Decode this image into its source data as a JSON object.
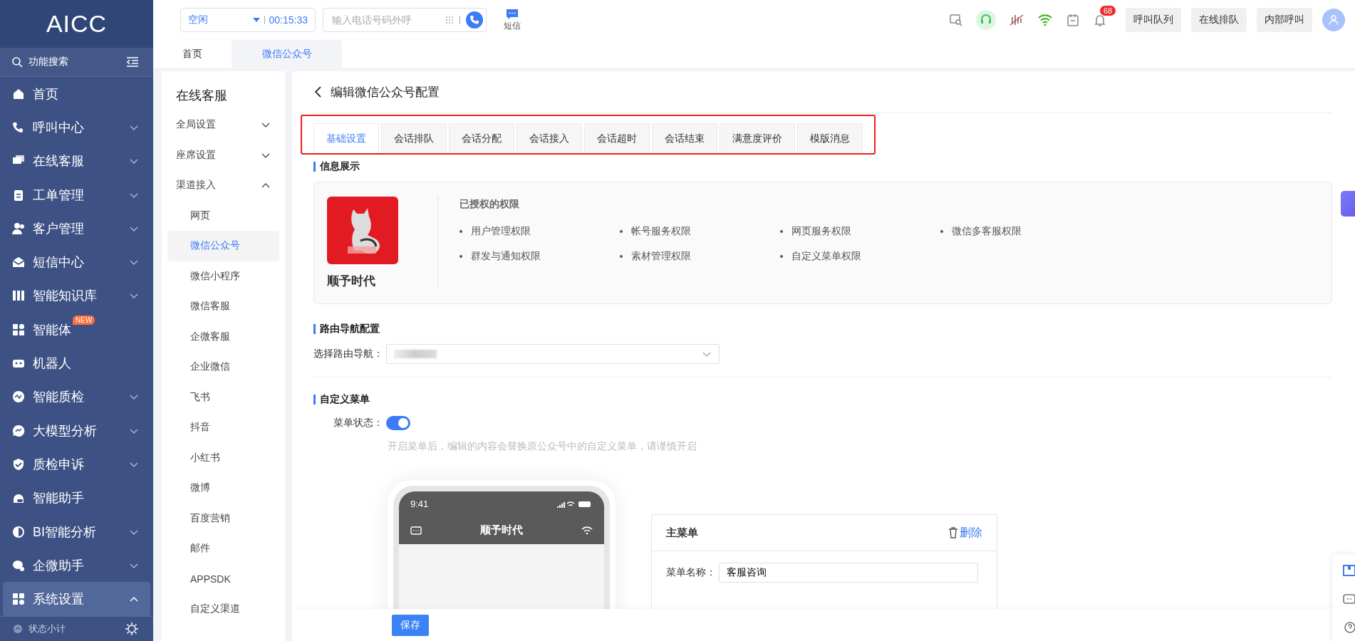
{
  "sidebar": {
    "logo": "AICC",
    "search": "功能搜索",
    "items": [
      {
        "label": "首页",
        "has_children": false,
        "selected": false
      },
      {
        "label": "呼叫中心",
        "has_children": true,
        "expanded": false,
        "selected": false
      },
      {
        "label": "在线客服",
        "has_children": true,
        "expanded": false,
        "selected": false
      },
      {
        "label": "工单管理",
        "has_children": true,
        "expanded": false,
        "selected": false
      },
      {
        "label": "客户管理",
        "has_children": true,
        "expanded": false,
        "selected": false
      },
      {
        "label": "短信中心",
        "has_children": true,
        "expanded": false,
        "selected": false
      },
      {
        "label": "智能知识库",
        "has_children": true,
        "expanded": false,
        "selected": false
      },
      {
        "label": "智能体",
        "has_children": false,
        "selected": false,
        "badge": "NEW"
      },
      {
        "label": "机器人",
        "has_children": false,
        "selected": false
      },
      {
        "label": "智能质检",
        "has_children": true,
        "expanded": false,
        "selected": false
      },
      {
        "label": "大模型分析",
        "has_children": true,
        "expanded": false,
        "selected": false
      },
      {
        "label": "质检申诉",
        "has_children": true,
        "expanded": false,
        "selected": false
      },
      {
        "label": "智能助手",
        "has_children": false,
        "selected": false
      },
      {
        "label": "BI智能分析",
        "has_children": true,
        "expanded": false,
        "selected": false
      },
      {
        "label": "企微助手",
        "has_children": true,
        "expanded": false,
        "selected": false
      },
      {
        "label": "系统设置",
        "has_children": true,
        "expanded": true,
        "selected": true
      }
    ],
    "footer": "状态小计"
  },
  "header": {
    "status": "空闲",
    "timer": "00:15:33",
    "dial_placeholder": "输入电话号码外呼",
    "sms_label": "短信",
    "notification_count": "68",
    "buttons": [
      "呼叫队列",
      "在线排队",
      "内部呼叫"
    ]
  },
  "page_tabs": [
    {
      "label": "首页",
      "selected": false
    },
    {
      "label": "微信公众号",
      "selected": true
    }
  ],
  "subnav": {
    "title": "在线客服",
    "groups": [
      {
        "label": "全局设置",
        "expanded": false
      },
      {
        "label": "座席设置",
        "expanded": false
      },
      {
        "label": "渠道接入",
        "expanded": true,
        "children": [
          {
            "label": "网页",
            "selected": false
          },
          {
            "label": "微信公众号",
            "selected": true
          },
          {
            "label": "微信小程序",
            "selected": false
          },
          {
            "label": "微信客服",
            "selected": false
          },
          {
            "label": "企微客服",
            "selected": false
          },
          {
            "label": "企业微信",
            "selected": false
          },
          {
            "label": "飞书",
            "selected": false
          },
          {
            "label": "抖音",
            "selected": false
          },
          {
            "label": "小红书",
            "selected": false
          },
          {
            "label": "微博",
            "selected": false
          },
          {
            "label": "百度营销",
            "selected": false
          },
          {
            "label": "邮件",
            "selected": false
          },
          {
            "label": "APPSDK",
            "selected": false
          },
          {
            "label": "自定义渠道",
            "selected": false
          }
        ]
      }
    ]
  },
  "editor": {
    "title": "编辑微信公众号配置",
    "tabs_highlighted": true,
    "tabs": [
      {
        "label": "基础设置",
        "selected": true
      },
      {
        "label": "会话排队",
        "selected": false
      },
      {
        "label": "会话分配",
        "selected": false
      },
      {
        "label": "会话接入",
        "selected": false
      },
      {
        "label": "会话超时",
        "selected": false
      },
      {
        "label": "会话结束",
        "selected": false
      },
      {
        "label": "满意度评价",
        "selected": false
      },
      {
        "label": "模版消息",
        "selected": false
      }
    ],
    "info": {
      "heading": "信息展示",
      "account_name": "顺予时代",
      "permissions_title": "已授权的权限",
      "permissions": [
        "用户管理权限",
        "帐号服务权限",
        "网页服务权限",
        "微信多客服权限",
        "群发与通知权限",
        "素材管理权限",
        "自定义菜单权限"
      ]
    },
    "routing": {
      "heading": "路由导航配置",
      "label": "选择路由导航："
    },
    "custom_menu": {
      "heading": "自定义菜单",
      "status_label": "菜单状态：",
      "menu_on": true,
      "hint": "开启菜单后，编辑的内容会替换原公众号中的自定义菜单，请谨慎开启",
      "phone": {
        "time": "9:41",
        "title": "顺予时代"
      },
      "panel": {
        "title": "主菜单",
        "delete": "删除",
        "name_label": "菜单名称：",
        "name_value": "客服咨询"
      }
    },
    "save": "保存"
  }
}
